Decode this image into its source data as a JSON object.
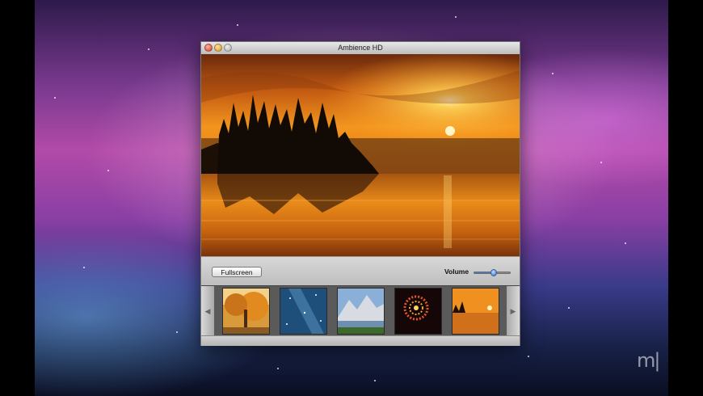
{
  "window": {
    "title": "Ambience HD"
  },
  "controls": {
    "fullscreen_label": "Fullscreen",
    "volume_label": "Volume",
    "volume_level": 0.55
  },
  "thumbnails": [
    {
      "scene": "autumn-tree"
    },
    {
      "scene": "starry-sky"
    },
    {
      "scene": "mountain-lake"
    },
    {
      "scene": "fireworks"
    },
    {
      "scene": "sunset-lake"
    }
  ],
  "icons": {
    "thumb_prev": "chevron-left-icon",
    "thumb_next": "chevron-right-icon"
  },
  "colors": {
    "sunset_orange": "#f08a1c",
    "volume_accent": "#2e6bd1"
  }
}
